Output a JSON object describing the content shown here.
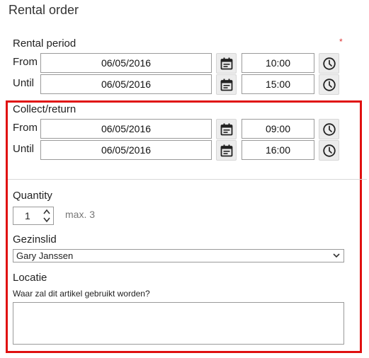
{
  "page": {
    "title": "Rental order"
  },
  "rental_period": {
    "label": "Rental period",
    "required_marker": "*",
    "from": {
      "label": "From",
      "date": "06/05/2016",
      "time": "10:00"
    },
    "until": {
      "label": "Until",
      "date": "06/05/2016",
      "time": "15:00"
    }
  },
  "collect_return": {
    "label": "Collect/return",
    "from": {
      "label": "From",
      "date": "06/05/2016",
      "time": "09:00"
    },
    "until": {
      "label": "Until",
      "date": "06/05/2016",
      "time": "16:00"
    }
  },
  "quantity": {
    "label": "Quantity",
    "value": "1",
    "max_text": "max. 3"
  },
  "gezinslid": {
    "label": "Gezinslid",
    "selected": "Gary Janssen"
  },
  "locatie": {
    "label": "Locatie",
    "hint": "Waar zal dit artikel gebruikt worden?",
    "value": ""
  },
  "icons": {
    "calendar": "calendar-icon",
    "clock": "clock-icon",
    "chevron": "chevron-down-icon"
  },
  "colors": {
    "highlight": "#e01010",
    "required": "#dd3333"
  }
}
